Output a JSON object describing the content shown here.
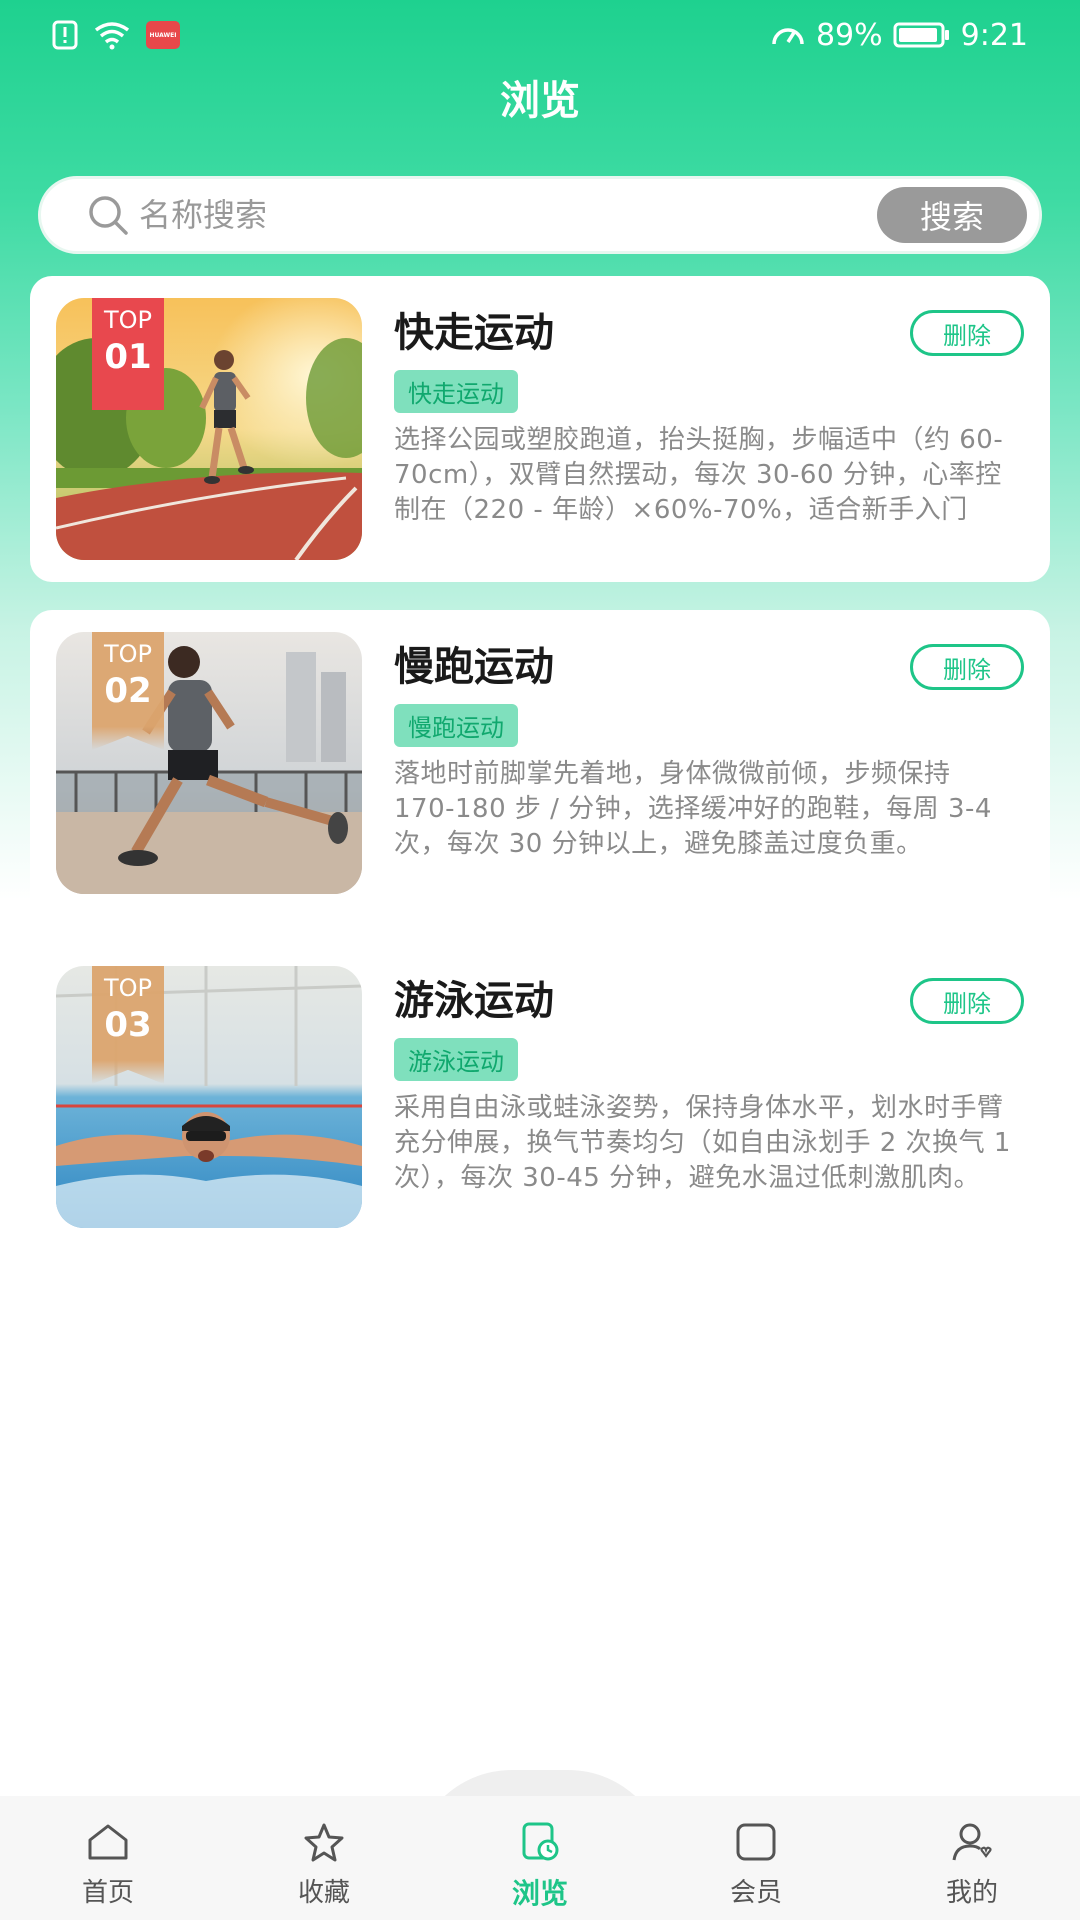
{
  "status_bar": {
    "battery": "89%",
    "time": "9:21",
    "icons": [
      "alert-icon",
      "wifi-icon",
      "huawei-app-icon",
      "speed-icon",
      "battery-icon"
    ],
    "huawei_label": "HUAWEI"
  },
  "header": {
    "title": "浏览"
  },
  "search": {
    "placeholder": "名称搜索",
    "value": "",
    "button_label": "搜索"
  },
  "items": [
    {
      "rank_top": "TOP",
      "rank_num": "01",
      "title": "快走运动",
      "tag": "快走运动",
      "description": "选择公园或塑胶跑道，抬头挺胸，步幅适中（约 60-70cm），双臂自然摆动，每次 30-60 分钟，心率控制在（220 - 年龄）×60%-70%，适合新手入门",
      "delete_label": "删除"
    },
    {
      "rank_top": "TOP",
      "rank_num": "02",
      "title": "慢跑运动",
      "tag": "慢跑运动",
      "description": "落地时前脚掌先着地，身体微微前倾，步频保持 170-180 步 / 分钟，选择缓冲好的跑鞋，每周 3-4 次，每次 30 分钟以上，避免膝盖过度负重。",
      "delete_label": "删除"
    },
    {
      "rank_top": "TOP",
      "rank_num": "03",
      "title": "游泳运动",
      "tag": "游泳运动",
      "description": "采用自由泳或蛙泳姿势，保持身体水平，划水时手臂充分伸展，换气节奏均匀（如自由泳划手 2 次换气 1 次），每次 30-45 分钟，避免水温过低刺激肌肉。",
      "delete_label": "删除"
    }
  ],
  "tabbar": {
    "tabs": [
      {
        "label": "首页",
        "icon": "home-icon"
      },
      {
        "label": "收藏",
        "icon": "star-icon"
      },
      {
        "label": "浏览",
        "icon": "browse-icon"
      },
      {
        "label": "会员",
        "icon": "member-icon"
      },
      {
        "label": "我的",
        "icon": "profile-icon"
      }
    ],
    "active": "浏览"
  },
  "colors": {
    "accent": "#1ec588",
    "header_gradient_top": "#1ed18f",
    "rank_1": "#e8484e",
    "rank_other": "#dca56e",
    "tag_bg": "#7fe0bd"
  }
}
